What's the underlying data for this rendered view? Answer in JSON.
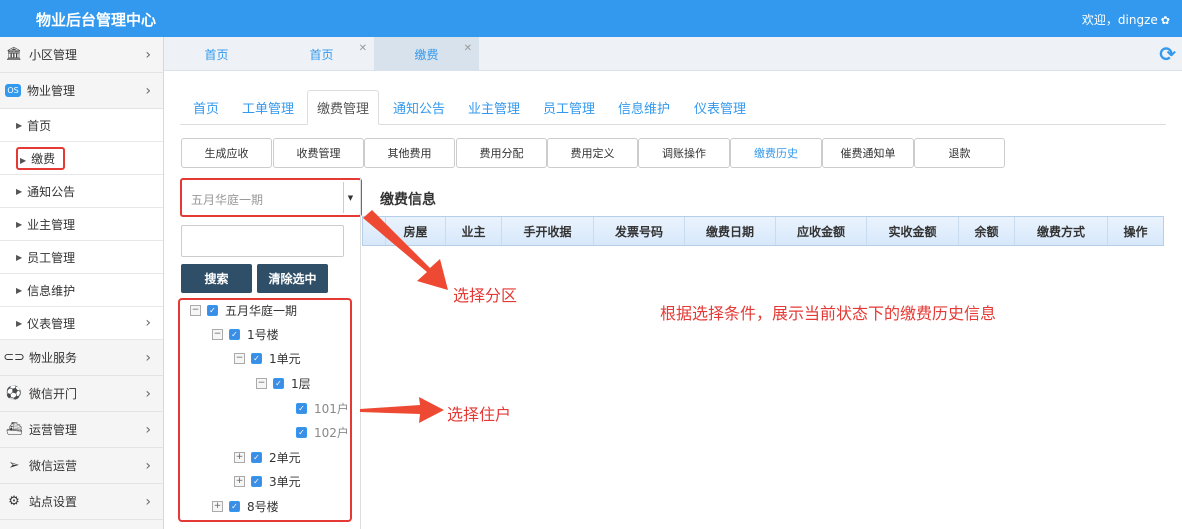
{
  "header": {
    "title": "物业后台管理中心",
    "welcome": "欢迎，dingze"
  },
  "sidebar": {
    "items": [
      {
        "label": "小区管理",
        "icon": "bank-icon"
      },
      {
        "label": "物业管理",
        "icon": "os-icon",
        "open": true
      }
    ],
    "subitems": [
      {
        "label": "首页"
      },
      {
        "label": "缴费",
        "active": true
      },
      {
        "label": "通知公告"
      },
      {
        "label": "业主管理"
      },
      {
        "label": "员工管理"
      },
      {
        "label": "信息维护"
      },
      {
        "label": "仪表管理",
        "has_children": true
      }
    ],
    "items_after": [
      {
        "label": "物业服务",
        "icon": "toggle-icon"
      },
      {
        "label": "微信开门",
        "icon": "soccer-icon"
      },
      {
        "label": "运营管理",
        "icon": "ship-icon"
      },
      {
        "label": "微信运营",
        "icon": "paper-plane-icon"
      },
      {
        "label": "站点设置",
        "icon": "gears-icon"
      }
    ]
  },
  "page_tabs": [
    {
      "label": "首页"
    },
    {
      "label": "首页",
      "closable": true
    },
    {
      "label": "缴费",
      "closable": true,
      "active": true
    }
  ],
  "subnav": [
    {
      "label": "首页"
    },
    {
      "label": "工单管理"
    },
    {
      "label": "缴费管理",
      "active": true
    },
    {
      "label": "通知公告"
    },
    {
      "label": "业主管理"
    },
    {
      "label": "员工管理"
    },
    {
      "label": "信息维护"
    },
    {
      "label": "仪表管理"
    }
  ],
  "function_buttons": [
    {
      "label": "生成应收"
    },
    {
      "label": "收费管理"
    },
    {
      "label": "其他费用"
    },
    {
      "label": "费用分配"
    },
    {
      "label": "费用定义"
    },
    {
      "label": "调账操作"
    },
    {
      "label": "缴费历史",
      "active": true
    },
    {
      "label": "催费通知单"
    },
    {
      "label": "退款"
    }
  ],
  "filter": {
    "area_select": "五月华庭一期",
    "search_value": "",
    "search_button": "搜索",
    "clear_button": "清除选中"
  },
  "tree": [
    {
      "label": "五月华庭一期",
      "level": 0,
      "expander": "−",
      "checked": true
    },
    {
      "label": "1号楼",
      "level": 1,
      "expander": "−",
      "checked": true
    },
    {
      "label": "1单元",
      "level": 2,
      "expander": "−",
      "checked": true
    },
    {
      "label": "1层",
      "level": 3,
      "expander": "−",
      "checked": true
    },
    {
      "label": "101户",
      "level": 4,
      "expander": "",
      "checked": true,
      "leaf": true
    },
    {
      "label": "102户",
      "level": 4,
      "expander": "",
      "checked": true,
      "leaf": true
    },
    {
      "label": "2单元",
      "level": 2,
      "expander": "+",
      "checked": true
    },
    {
      "label": "3单元",
      "level": 2,
      "expander": "+",
      "checked": true
    },
    {
      "label": "8号楼",
      "level": 1,
      "expander": "+",
      "checked": true
    }
  ],
  "panel": {
    "title": "缴费信息",
    "columns": [
      "房屋",
      "业主",
      "手开收据",
      "发票号码",
      "缴费日期",
      "应收金额",
      "实收金额",
      "余额",
      "缴费方式",
      "操作"
    ]
  },
  "annotations": {
    "select_area": "选择分区",
    "select_household": "选择住户",
    "description": "根据选择条件，展示当前状态下的缴费历史信息"
  },
  "colors": {
    "brand": "#3399ee",
    "annotation": "#e53935",
    "dark_button": "#2f4e67"
  }
}
